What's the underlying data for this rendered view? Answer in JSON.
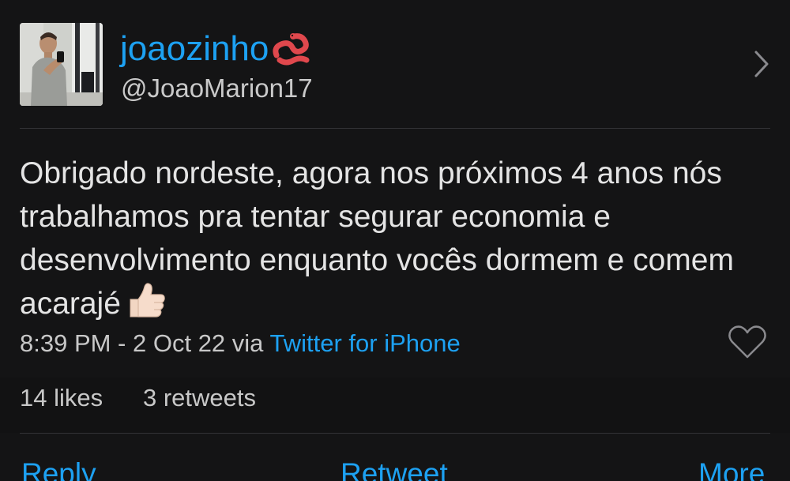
{
  "user": {
    "display_name": "joaozinho",
    "name_emoji": "worm-emoji",
    "handle": "@JoaoMarion17",
    "avatar": "profile-photo"
  },
  "tweet": {
    "text": "Obrigado nordeste, agora nos próximos 4 anos nós trabalhamos pra tentar segurar economia e desenvolvimento enquanto vocês dormem e comem acarajé",
    "trailing_emoji": "thumbs-up-emoji",
    "timestamp": "8:39 PM - 2 Oct 22",
    "via_label": "via",
    "source": "Twitter for iPhone"
  },
  "stats": {
    "likes": "14 likes",
    "retweets": "3 retweets"
  },
  "actions": {
    "reply": "Reply",
    "retweet": "Retweet",
    "more": "More"
  },
  "colors": {
    "background": "#141415",
    "accent": "#1da1f2",
    "text": "#e4e4e4",
    "divider": "#333336"
  }
}
